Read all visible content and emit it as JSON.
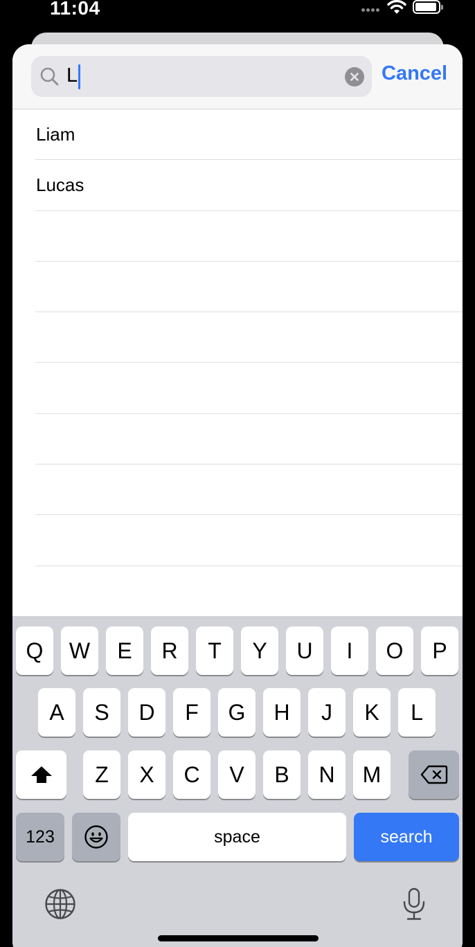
{
  "status_bar": {
    "time": "11:04"
  },
  "search": {
    "query": "L",
    "cancel_label": "Cancel"
  },
  "results": [
    "Liam",
    "Lucas",
    "",
    "",
    "",
    "",
    "",
    "",
    "",
    ""
  ],
  "keyboard": {
    "row1": [
      "Q",
      "W",
      "E",
      "R",
      "T",
      "Y",
      "U",
      "I",
      "O",
      "P"
    ],
    "row2": [
      "A",
      "S",
      "D",
      "F",
      "G",
      "H",
      "J",
      "K",
      "L"
    ],
    "row3": [
      "Z",
      "X",
      "C",
      "V",
      "B",
      "N",
      "M"
    ],
    "numbers_label": "123",
    "space_label": "space",
    "search_label": "search"
  },
  "colors": {
    "accent": "#3478f6",
    "keyboard_bg": "#d1d3d9",
    "dark_key": "#abafba"
  },
  "icons": [
    "search-icon",
    "clear-icon",
    "wifi-icon",
    "battery-icon",
    "shift-icon",
    "delete-icon",
    "emoji-icon",
    "globe-icon",
    "microphone-icon"
  ]
}
